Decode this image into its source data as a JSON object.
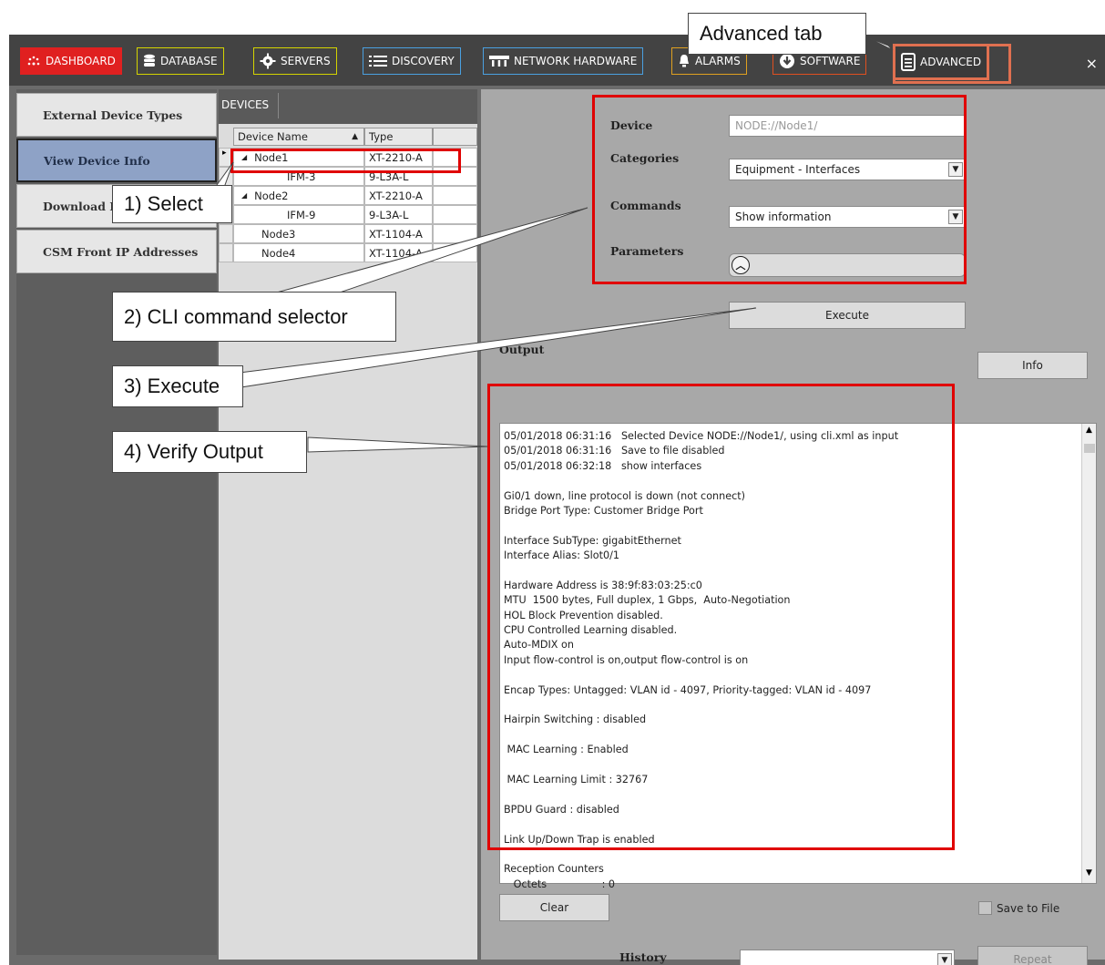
{
  "tabs": [
    {
      "label": "DASHBOARD",
      "icon": "dashboard-icon",
      "border": "#e02020",
      "bg": "#e02020"
    },
    {
      "label": "DATABASE",
      "icon": "database-icon",
      "border": "#d4d400",
      "bg": "transparent"
    },
    {
      "label": "SERVERS",
      "icon": "gear-icon",
      "border": "#d4d400",
      "bg": "transparent"
    },
    {
      "label": "DISCOVERY",
      "icon": "list-icon",
      "border": "#4aa0e0",
      "bg": "transparent"
    },
    {
      "label": "NETWORK HARDWARE",
      "icon": "network-hardware-icon",
      "border": "#4aa0e0",
      "bg": "transparent"
    },
    {
      "label": "ALARMS",
      "icon": "alarm-icon",
      "border": "#e0a020",
      "bg": "transparent"
    },
    {
      "label": "SOFTWARE",
      "icon": "download-icon",
      "border": "#e05020",
      "bg": "transparent"
    },
    {
      "label": "ADVANCED",
      "icon": "document-icon",
      "border": "#e07050",
      "bg": "#3a3a3a"
    }
  ],
  "close_glyph": "×",
  "nav": [
    {
      "label": "External Device Types",
      "active": false
    },
    {
      "label": "View Device Info",
      "active": true
    },
    {
      "label": "Download L",
      "active": false
    },
    {
      "label": "CSM Front IP Addresses",
      "active": false
    }
  ],
  "devices": {
    "tab_label": "DEVICES",
    "columns": [
      "Device Name",
      "Type"
    ],
    "sort_glyph": "▲",
    "rows": [
      {
        "name": "Node1",
        "type": "XT-2210-A",
        "indent": 1,
        "expander": "◢",
        "selected": true
      },
      {
        "name": "IFM-3",
        "type": "9-L3A-L",
        "indent": 2,
        "expander": "",
        "selected": false
      },
      {
        "name": "Node2",
        "type": "XT-2210-A",
        "indent": 1,
        "expander": "◢",
        "selected": false
      },
      {
        "name": "IFM-9",
        "type": "9-L3A-L",
        "indent": 2,
        "expander": "",
        "selected": false
      },
      {
        "name": "Node3",
        "type": "XT-1104-A",
        "indent": 0,
        "expander": "",
        "selected": false
      },
      {
        "name": "Node4",
        "type": "XT-1104-A",
        "indent": 0,
        "expander": "",
        "selected": false
      }
    ]
  },
  "form": {
    "device_label": "Device",
    "device_placeholder": "NODE://Node1/",
    "categories_label": "Categories",
    "categories_value": "Equipment - Interfaces",
    "commands_label": "Commands",
    "commands_value": "Show information",
    "parameters_label": "Parameters",
    "parameters_glyph": "︿",
    "execute_label": "Execute",
    "output_label": "Output",
    "info_label": "Info",
    "clear_label": "Clear",
    "save_to_file_label": "Save to File",
    "history_label": "History",
    "history_value": "",
    "repeat_label": "Repeat"
  },
  "output_lines": [
    "05/01/2018 06:31:16   Selected Device NODE://Node1/, using cli.xml as input",
    "05/01/2018 06:31:16   Save to file disabled",
    "05/01/2018 06:32:18   show interfaces",
    "",
    "Gi0/1 down, line protocol is down (not connect)",
    "Bridge Port Type: Customer Bridge Port",
    "",
    "Interface SubType: gigabitEthernet",
    "Interface Alias: Slot0/1",
    "",
    "Hardware Address is 38:9f:83:03:25:c0",
    "MTU  1500 bytes, Full duplex, 1 Gbps,  Auto-Negotiation",
    "HOL Block Prevention disabled.",
    "CPU Controlled Learning disabled.",
    "Auto-MDIX on",
    "Input flow-control is on,output flow-control is on",
    "",
    "Encap Types: Untagged: VLAN id - 4097, Priority-tagged: VLAN id - 4097",
    "",
    "Hairpin Switching : disabled",
    "",
    " MAC Learning : Enabled",
    "",
    " MAC Learning Limit : 32767",
    "",
    "BPDU Guard : disabled",
    "",
    "Link Up/Down Trap is enabled",
    "",
    "Reception Counters",
    "   Octets                 : 0"
  ],
  "callouts": {
    "advanced_tab": "Advanced tab",
    "select": "1) Select",
    "cli_selector": "2) CLI command selector",
    "execute": "3) Execute",
    "verify": "4) Verify Output"
  },
  "colors": {
    "highlight": "#e00000",
    "active_nav": "#8ea2c6"
  }
}
